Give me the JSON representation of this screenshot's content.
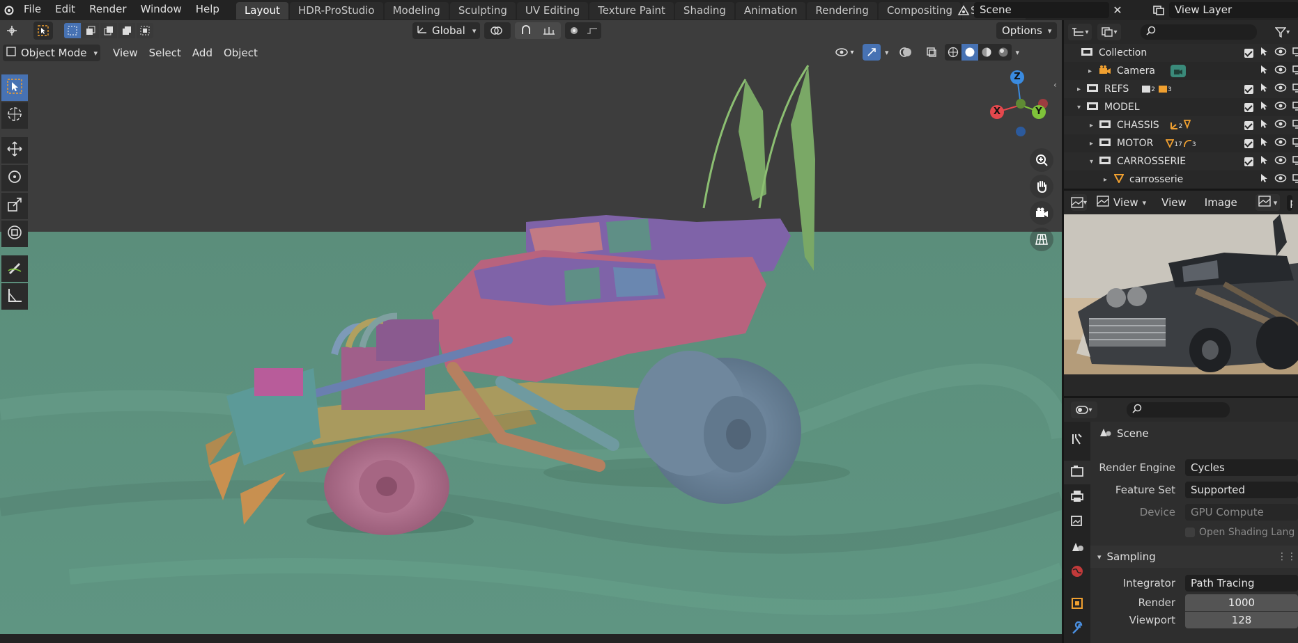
{
  "topbar": {
    "menus": [
      "File",
      "Edit",
      "Render",
      "Window",
      "Help"
    ],
    "workspaces": [
      "Layout",
      "HDR-ProStudio",
      "Modeling",
      "Sculpting",
      "UV Editing",
      "Texture Paint",
      "Shading",
      "Animation",
      "Rendering",
      "Compositing",
      "Scripting"
    ],
    "active_workspace": "Layout",
    "scene": "Scene",
    "view_layer": "View Layer"
  },
  "viewport": {
    "transform_orientation": "Global",
    "options_label": "Options",
    "mode": "Object Mode",
    "menus": [
      "View",
      "Select",
      "Add",
      "Object"
    ],
    "gizmo_axes": {
      "x": "X",
      "y": "Y",
      "z": "Z"
    }
  },
  "outliner": {
    "rows": [
      {
        "label": "Collection",
        "badges": []
      },
      {
        "label": "Camera",
        "badges": []
      },
      {
        "label": "REFS",
        "badges": [
          "2",
          "3"
        ]
      },
      {
        "label": "MODEL",
        "badges": []
      },
      {
        "label": "CHASSIS",
        "badges": [
          "2"
        ]
      },
      {
        "label": "MOTOR",
        "badges": [
          "17",
          "3"
        ]
      },
      {
        "label": "CARROSSERIE",
        "badges": []
      },
      {
        "label": "carrosserie",
        "badges": []
      }
    ]
  },
  "image_editor": {
    "menus": [
      "View",
      "View",
      "Image"
    ],
    "partial_label": "p"
  },
  "properties": {
    "context": "Scene",
    "render_engine_label": "Render Engine",
    "render_engine": "Cycles",
    "feature_set_label": "Feature Set",
    "feature_set": "Supported",
    "device_label": "Device",
    "device": "GPU Compute",
    "open_shading_label": "Open Shading Lang",
    "sampling_label": "Sampling",
    "integrator_label": "Integrator",
    "integrator": "Path Tracing",
    "render_label": "Render",
    "render_samples": "1000",
    "viewport_label": "Viewport",
    "viewport_samples": "128"
  },
  "colors": {
    "accent": "#4772b3",
    "ground": "#5e9380",
    "axis_x": "#e5484d",
    "axis_y": "#7fc33a",
    "axis_z": "#3a8be0"
  }
}
